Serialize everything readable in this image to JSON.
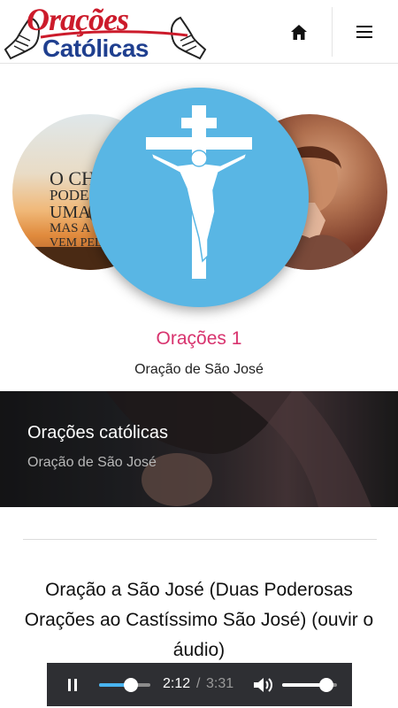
{
  "header": {
    "logo": {
      "line1": "Orações",
      "line2": "Católicas"
    },
    "home_icon": "home-icon",
    "menu_icon": "hamburger-menu-icon"
  },
  "carousel": {
    "left_slide": {
      "text_lines": [
        "O CHO",
        "PODE D",
        "UMA N",
        "MAS A",
        "VEM PEL"
      ]
    },
    "main_icon": "crucifix-icon",
    "title": "Orações 1",
    "subtitle": "Oração de São José"
  },
  "banner": {
    "title": "Orações católicas",
    "subtitle": "Oração de São José"
  },
  "article": {
    "title": "Oração a São José (Duas Poderosas Orações ao Castíssimo São José) (ouvir o áudio)"
  },
  "player": {
    "current_time": "2:12",
    "separator": "/",
    "duration": "3:31",
    "progress": 0.625,
    "volume": 0.8,
    "icons": {
      "play_pause": "pause-icon",
      "volume": "volume-icon"
    }
  },
  "colors": {
    "accent_pink": "#d8336e",
    "crucifix_bg": "#59b6e4",
    "logo_red": "#cc1b2b",
    "logo_blue": "#1f3f8f",
    "player_bg": "#2e2f33",
    "seek_fill": "#49b4f0"
  }
}
